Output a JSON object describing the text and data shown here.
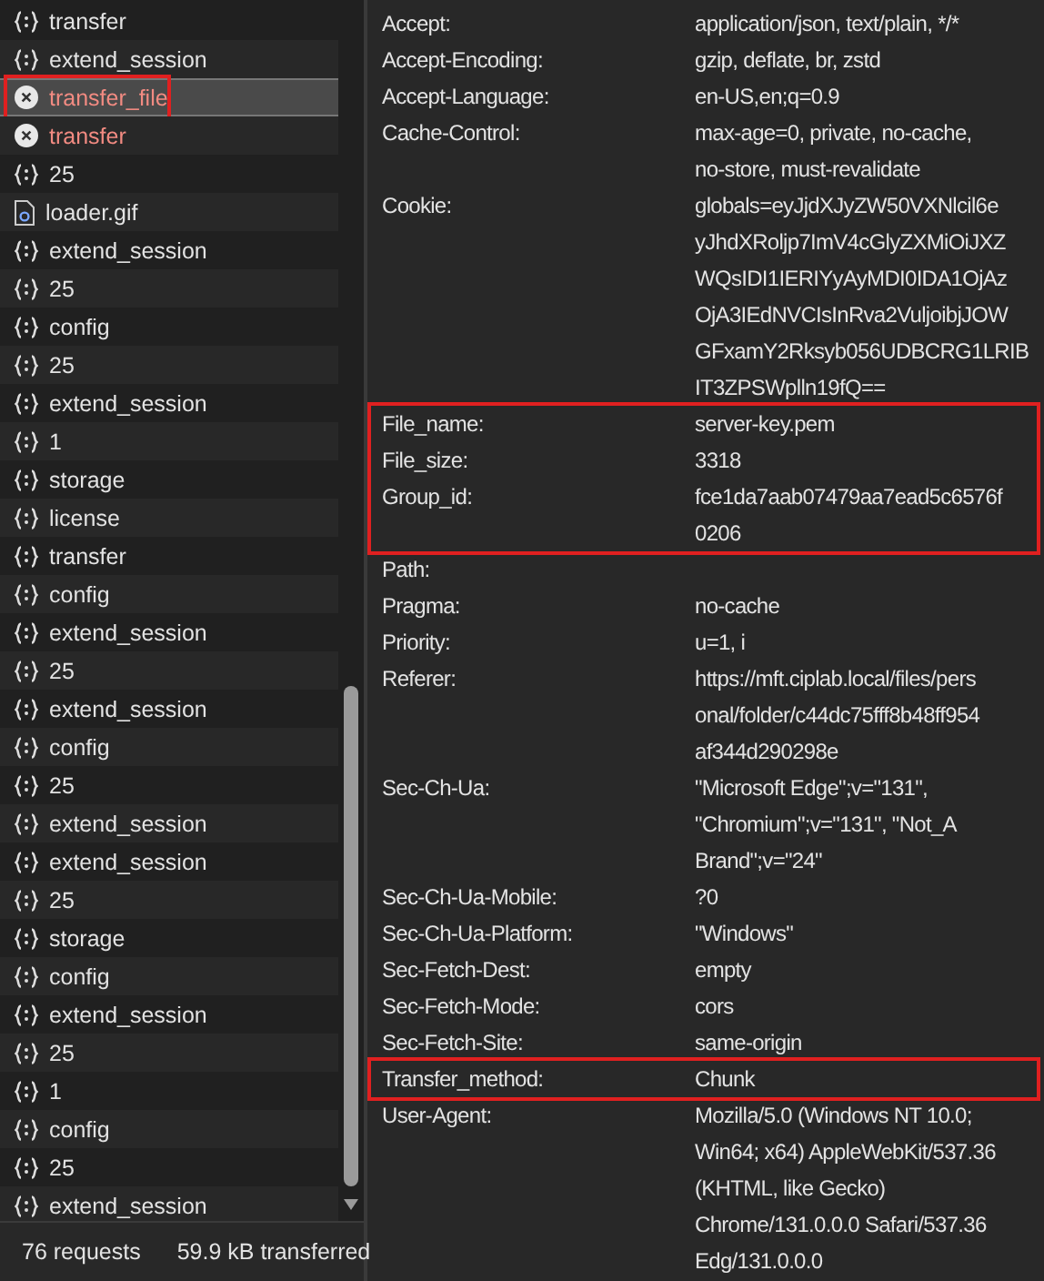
{
  "requests": [
    {
      "name": "transfer",
      "kind": "xhr",
      "selected": false,
      "highlighted": false
    },
    {
      "name": "extend_session",
      "kind": "xhr",
      "selected": false,
      "highlighted": false
    },
    {
      "name": "transfer_file",
      "kind": "error",
      "selected": true,
      "highlighted": true
    },
    {
      "name": "transfer",
      "kind": "error",
      "selected": false,
      "highlighted": false
    },
    {
      "name": "25",
      "kind": "xhr",
      "selected": false,
      "highlighted": false
    },
    {
      "name": "loader.gif",
      "kind": "file",
      "selected": false,
      "highlighted": false
    },
    {
      "name": "extend_session",
      "kind": "xhr",
      "selected": false,
      "highlighted": false
    },
    {
      "name": "25",
      "kind": "xhr",
      "selected": false,
      "highlighted": false
    },
    {
      "name": "config",
      "kind": "xhr",
      "selected": false,
      "highlighted": false
    },
    {
      "name": "25",
      "kind": "xhr",
      "selected": false,
      "highlighted": false
    },
    {
      "name": "extend_session",
      "kind": "xhr",
      "selected": false,
      "highlighted": false
    },
    {
      "name": "1",
      "kind": "xhr",
      "selected": false,
      "highlighted": false
    },
    {
      "name": "storage",
      "kind": "xhr",
      "selected": false,
      "highlighted": false
    },
    {
      "name": "license",
      "kind": "xhr",
      "selected": false,
      "highlighted": false
    },
    {
      "name": "transfer",
      "kind": "xhr",
      "selected": false,
      "highlighted": false
    },
    {
      "name": "config",
      "kind": "xhr",
      "selected": false,
      "highlighted": false
    },
    {
      "name": "extend_session",
      "kind": "xhr",
      "selected": false,
      "highlighted": false
    },
    {
      "name": "25",
      "kind": "xhr",
      "selected": false,
      "highlighted": false
    },
    {
      "name": "extend_session",
      "kind": "xhr",
      "selected": false,
      "highlighted": false
    },
    {
      "name": "config",
      "kind": "xhr",
      "selected": false,
      "highlighted": false
    },
    {
      "name": "25",
      "kind": "xhr",
      "selected": false,
      "highlighted": false
    },
    {
      "name": "extend_session",
      "kind": "xhr",
      "selected": false,
      "highlighted": false
    },
    {
      "name": "extend_session",
      "kind": "xhr",
      "selected": false,
      "highlighted": false
    },
    {
      "name": "25",
      "kind": "xhr",
      "selected": false,
      "highlighted": false
    },
    {
      "name": "storage",
      "kind": "xhr",
      "selected": false,
      "highlighted": false
    },
    {
      "name": "config",
      "kind": "xhr",
      "selected": false,
      "highlighted": false
    },
    {
      "name": "extend_session",
      "kind": "xhr",
      "selected": false,
      "highlighted": false
    },
    {
      "name": "25",
      "kind": "xhr",
      "selected": false,
      "highlighted": false
    },
    {
      "name": "1",
      "kind": "xhr",
      "selected": false,
      "highlighted": false
    },
    {
      "name": "config",
      "kind": "xhr",
      "selected": false,
      "highlighted": false
    },
    {
      "name": "25",
      "kind": "xhr",
      "selected": false,
      "highlighted": false
    },
    {
      "name": "extend_session",
      "kind": "xhr",
      "selected": false,
      "highlighted": false
    }
  ],
  "status_bar": {
    "requests": "76 requests",
    "transferred": "59.9 kB transferred"
  },
  "header_groups": [
    {
      "highlighted": false,
      "headers": [
        {
          "name": "Accept:",
          "value": [
            "application/json, text/plain, */*"
          ]
        },
        {
          "name": "Accept-Encoding:",
          "value": [
            "gzip, deflate, br, zstd"
          ]
        },
        {
          "name": "Accept-Language:",
          "value": [
            "en-US,en;q=0.9"
          ]
        },
        {
          "name": "Cache-Control:",
          "value": [
            "max-age=0, private, no-cache,",
            "no-store, must-revalidate"
          ]
        },
        {
          "name": "Cookie:",
          "value": [
            "globals=eyJjdXJyZW50VXNlcil6e",
            "yJhdXRoljp7ImV4cGlyZXMiOiJXZ",
            "WQsIDI1IERIYyAyMDI0IDA1OjAz",
            "OjA3IEdNVCIsInRva2VuljoibjJOW",
            "GFxamY2Rksyb056UDBCRG1LRIB",
            "IT3ZPSWplln19fQ=="
          ]
        }
      ]
    },
    {
      "highlighted": true,
      "headers": [
        {
          "name": "File_name:",
          "value": [
            "server-key.pem"
          ]
        },
        {
          "name": "File_size:",
          "value": [
            "3318"
          ]
        },
        {
          "name": "Group_id:",
          "value": [
            "fce1da7aab07479aa7ead5c6576f",
            "0206"
          ]
        }
      ]
    },
    {
      "highlighted": false,
      "headers": [
        {
          "name": "Path:"
        },
        {
          "name": "Pragma:",
          "value": [
            "no-cache"
          ]
        },
        {
          "name": "Priority:",
          "value": [
            "u=1, i"
          ]
        },
        {
          "name": "Referer:",
          "value": [
            "https://mft.ciplab.local/files/pers",
            "onal/folder/c44dc75fff8b48ff954",
            "af344d290298e"
          ]
        },
        {
          "name": "Sec-Ch-Ua:",
          "value": [
            "\"Microsoft Edge\";v=\"131\",",
            "\"Chromium\";v=\"131\", \"Not_A",
            "Brand\";v=\"24\""
          ]
        },
        {
          "name": "Sec-Ch-Ua-Mobile:",
          "value": [
            "?0"
          ]
        },
        {
          "name": "Sec-Ch-Ua-Platform:",
          "value": [
            "\"Windows\""
          ]
        },
        {
          "name": "Sec-Fetch-Dest:",
          "value": [
            "empty"
          ]
        },
        {
          "name": "Sec-Fetch-Mode:",
          "value": [
            "cors"
          ]
        },
        {
          "name": "Sec-Fetch-Site:",
          "value": [
            "same-origin"
          ]
        }
      ]
    },
    {
      "highlighted": true,
      "headers": [
        {
          "name": "Transfer_method:",
          "value": [
            "Chunk"
          ]
        }
      ]
    },
    {
      "highlighted": false,
      "headers": [
        {
          "name": "User-Agent:",
          "value": [
            "Mozilla/5.0 (Windows NT 10.0;",
            "Win64; x64) AppleWebKit/537.36",
            "(KHTML, like Gecko)",
            "Chrome/131.0.0.0 Safari/537.36",
            "Edg/131.0.0.0"
          ]
        }
      ]
    }
  ]
}
